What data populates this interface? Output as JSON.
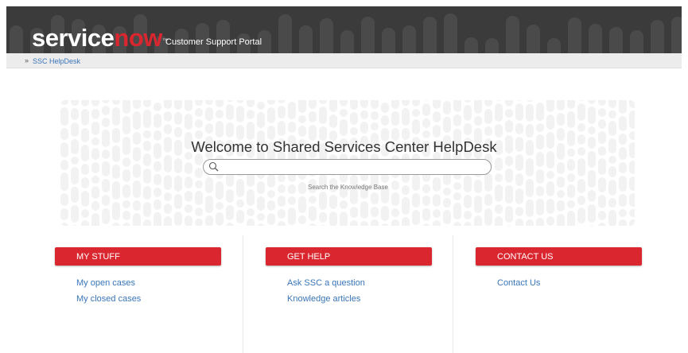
{
  "header": {
    "logo_service": "service",
    "logo_now": "now",
    "logo_tm": "™",
    "portal_name": "Customer Support Portal"
  },
  "breadcrumb": {
    "separator": "»",
    "current": "SSC HelpDesk"
  },
  "welcome": {
    "title": "Welcome to Shared Services Center HelpDesk",
    "search_value": "",
    "search_hint": "Search the Knowledge Base"
  },
  "columns": [
    {
      "title": "MY STUFF",
      "links": [
        "My open cases",
        "My closed cases"
      ]
    },
    {
      "title": "GET HELP",
      "links": [
        "Ask SSC a question",
        "Knowledge articles"
      ]
    },
    {
      "title": "CONTACT US",
      "links": [
        "Contact Us"
      ]
    }
  ],
  "colors": {
    "accent": "#d9262f",
    "link": "#3a75b8",
    "header_bg": "#3b3b3b"
  },
  "icons": {
    "search": "search-icon"
  }
}
